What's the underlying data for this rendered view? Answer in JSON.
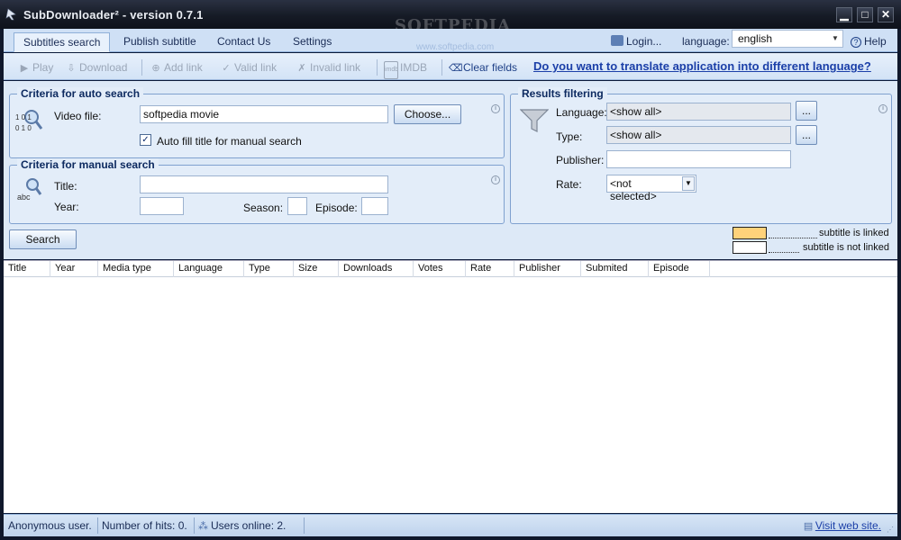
{
  "window": {
    "title": "SubDownloader² - version 0.7.1",
    "watermark": "SOFTPEDIA",
    "watermark_url": "www.softpedia.com",
    "minimize": "▁",
    "maximize": "□",
    "close": "✕"
  },
  "tabs": [
    {
      "label": "Subtitles search",
      "active": true
    },
    {
      "label": "Publish subtitle",
      "active": false
    },
    {
      "label": "Contact Us",
      "active": false
    },
    {
      "label": "Settings",
      "active": false
    }
  ],
  "header_right": {
    "login": "Login...",
    "language_label": "language:",
    "language_value": "english",
    "help": "Help"
  },
  "toolbar": {
    "play": "Play",
    "download": "Download",
    "add_link": "Add link",
    "valid_link": "Valid link",
    "invalid_link": "Invalid link",
    "imdb": "IMDB",
    "clear_fields": "Clear fields",
    "translate": "Do you want to translate application into different language?"
  },
  "auto_search": {
    "title": "Criteria for auto search",
    "video_file_label": "Video file:",
    "video_file_value": "softpedia movie",
    "choose_button": "Choose...",
    "auto_fill_label": "Auto fill title for manual search",
    "auto_fill_checked": true,
    "icon_digits": "1 0 1\n0 1 0"
  },
  "manual_search": {
    "title": "Criteria for manual search",
    "title_label": "Title:",
    "year_label": "Year:",
    "season_label": "Season:",
    "episode_label": "Episode:",
    "title_value": "",
    "year_value": "",
    "season_value": "",
    "episode_value": "",
    "icon_text": "abc"
  },
  "search_button": "Search",
  "results_filtering": {
    "title": "Results filtering",
    "language_label": "Language:",
    "language_value": "<show all>",
    "type_label": "Type:",
    "type_value": "<show all>",
    "publisher_label": "Publisher:",
    "publisher_value": "",
    "rate_label": "Rate:",
    "rate_value": "<not selected>",
    "more_button": "..."
  },
  "legend": {
    "linked": "subtitle is linked",
    "not_linked": "subtitle is not linked",
    "linked_color": "#ffd27a",
    "not_linked_color": "#ffffff"
  },
  "table": {
    "columns": [
      "Title",
      "Year",
      "Media type",
      "Language",
      "Type",
      "Size",
      "Downloads",
      "Votes",
      "Rate",
      "Publisher",
      "Submited",
      "Episode"
    ],
    "rows": []
  },
  "status": {
    "user": "Anonymous user.",
    "hits": "Number of hits: 0.",
    "online": "Users online: 2.",
    "visit": "Visit web site."
  },
  "colors": {
    "accent": "#1b3fa8",
    "panel": "#dde9f7",
    "titlebar": "#161b26"
  }
}
